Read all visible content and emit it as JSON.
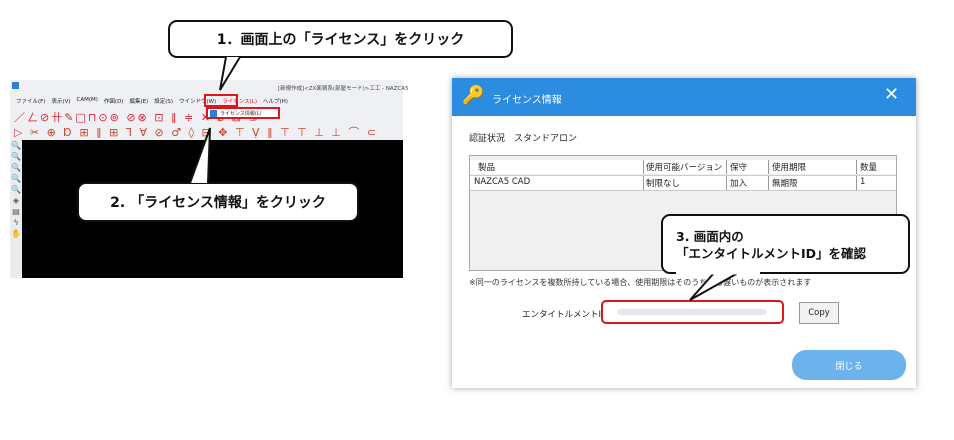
{
  "callouts": {
    "step1": "1．画面上の「ライセンス」をクリック",
    "step2": "2. 「ライセンス情報」をクリック",
    "step3_line1": "3. 画面内の",
    "step3_line2": "「エンタイトルメントID」を確認"
  },
  "cad": {
    "title": "[新規作成]<ZX面積系(部屋モード)>工工 - NAZCA5",
    "menu": [
      "ファイル(F)",
      "表示(V)",
      "CAM(M)",
      "作図(D)",
      "編集(E)",
      "設定(S)",
      "ウインドウ(W)",
      "ライセンス(L)",
      "ヘルプ(H)"
    ],
    "dropdown_item": "ライセンス情報(L)",
    "toolbar1": "／ㄥ⊘卄✎□⊓⊙⊚ ⊘⊗ ⊡ ‖ ≑ ✕ ⌀ ⊠ ♋",
    "toolbar2": "▷ ✂ ⊕ Ɒ ⊞ ‖ ⊞ ⅂ ∀ ⊘ ♂ ◊ ⊟ ✥ ⊤ Ṿ ‖ ⊤ ⊤ ⊥ ⊥ ⌒ ⊂",
    "left_icons": [
      "🔍",
      "🔍",
      "🔍",
      "🔍",
      "🔍",
      "◈",
      "▤",
      "ϟ",
      "✋"
    ]
  },
  "dialog": {
    "title": "ライセンス情報",
    "close_glyph": "✕",
    "key_glyph": "🔑",
    "auth_status": "認証状況　スタンドアロン",
    "table": {
      "headers": [
        "製品",
        "使用可能バージョン",
        "保守",
        "使用期限",
        "数量"
      ],
      "rows": [
        [
          "NAZCA5 CAD",
          "制限なし",
          "加入",
          "無期限",
          "1"
        ]
      ]
    },
    "note": "※同一のライセンスを複数所持している場合、使用期限はそのうち最も遅いものが表示されます",
    "entitlement_label": "エンタイトルメントID",
    "copy_label": "Copy",
    "close_label": "閉じる"
  },
  "colors": {
    "accent": "#2b8ce0",
    "highlight": "#e0141b",
    "close_button": "#6cb3ee"
  }
}
